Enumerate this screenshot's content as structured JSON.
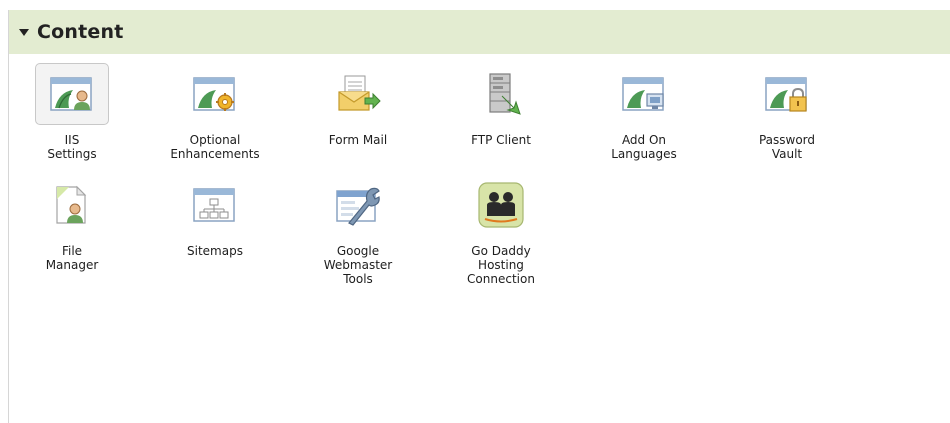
{
  "section": {
    "title": "Content",
    "accent_color": "#e3ecd1"
  },
  "items": [
    {
      "label_lines": [
        "IIS",
        "Settings"
      ],
      "icon": "iis-settings-icon"
    },
    {
      "label_lines": [
        "Optional",
        "Enhancements"
      ],
      "icon": "optional-enhancements-icon"
    },
    {
      "label_lines": [
        "Form Mail"
      ],
      "icon": "form-mail-icon"
    },
    {
      "label_lines": [
        "FTP Client"
      ],
      "icon": "ftp-client-icon"
    },
    {
      "label_lines": [
        "Add On",
        "Languages"
      ],
      "icon": "add-on-languages-icon"
    },
    {
      "label_lines": [
        "Password",
        "Vault"
      ],
      "icon": "password-vault-icon"
    },
    {
      "label_lines": [
        "File",
        "Manager"
      ],
      "icon": "file-manager-icon"
    },
    {
      "label_lines": [
        "Sitemaps"
      ],
      "icon": "sitemaps-icon"
    },
    {
      "label_lines": [
        "Google",
        "Webmaster",
        "Tools"
      ],
      "icon": "google-webmaster-tools-icon"
    },
    {
      "label_lines": [
        "Go Daddy",
        "Hosting",
        "Connection"
      ],
      "icon": "go-daddy-hosting-connection-icon"
    }
  ]
}
